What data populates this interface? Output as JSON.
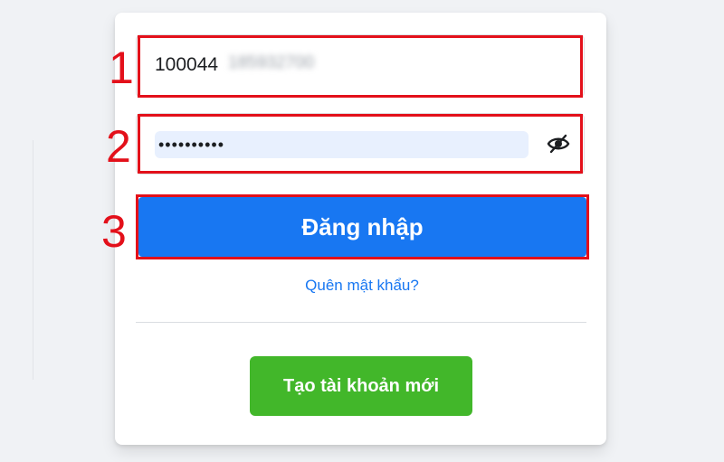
{
  "login_form": {
    "email_value": "100044",
    "email_blurred_suffix": "185932700",
    "password_value": "••••••••••",
    "login_button_label": "Đăng nhập",
    "forgot_password_label": "Quên mật khẩu?",
    "create_account_label": "Tạo tài khoản mới"
  },
  "annotations": {
    "step_1": "1",
    "step_2": "2",
    "step_3": "3",
    "highlight_color": "#e3101a"
  },
  "icons": {
    "password_toggle": "eye-slash-icon"
  },
  "colors": {
    "primary": "#1877f2",
    "create_account": "#42b72a",
    "background": "#f0f2f5",
    "autofill": "#e8f0fe"
  }
}
